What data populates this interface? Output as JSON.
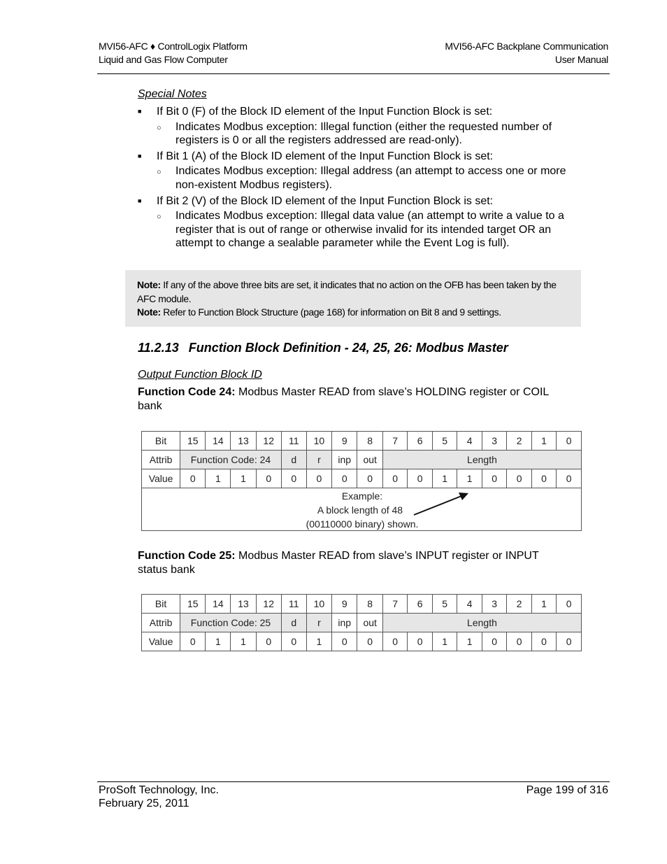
{
  "header": {
    "left_line1": "MVI56-AFC ♦ ControlLogix Platform",
    "left_line2": "Liquid and Gas Flow Computer",
    "right_line1": "MVI56-AFC Backplane Communication",
    "right_line2": "User Manual"
  },
  "special_notes": {
    "title": "Special Notes",
    "items": [
      {
        "text": "If Bit 0 (F) of the Block ID element of the Input Function Block is set:",
        "sub": "Indicates Modbus exception: Illegal function (either the requested number of registers is 0 or all the registers addressed are read-only)."
      },
      {
        "text": "If Bit 1 (A) of the Block ID element of the Input Function Block is set:",
        "sub": "Indicates Modbus exception: Illegal address (an attempt to access one or more non-existent Modbus registers)."
      },
      {
        "text": "If Bit 2 (V) of the Block ID element of the Input Function Block is set:",
        "sub": "Indicates Modbus exception: Illegal data value (an attempt to write a value to a register that is out of range or otherwise invalid for its intended target OR an attempt to change a sealable parameter while the Event Log is full)."
      }
    ]
  },
  "note_box": {
    "note1_label": "Note:",
    "note1_text": " If any of the above three bits are set, it indicates that no action on the OFB has been taken by the AFC module.",
    "note2_label": "Note:",
    "note2_text": " Refer to Function Block Structure (page 168) for information on Bit 8 and 9 settings."
  },
  "section": {
    "number": "11.2.13",
    "title": "Function Block Definition - 24, 25, 26: Modbus Master"
  },
  "ofb_title": "Output Function Block ID",
  "fc24": {
    "label": "Function Code 24:",
    "text": " Modbus Master READ from slave’s HOLDING register or COIL bank",
    "table": {
      "row_labels": [
        "Bit",
        "Attrib",
        "Value"
      ],
      "bits": [
        "15",
        "14",
        "13",
        "12",
        "11",
        "10",
        "9",
        "8",
        "7",
        "6",
        "5",
        "4",
        "3",
        "2",
        "1",
        "0"
      ],
      "attribs": {
        "function_code": "Function Code: 24",
        "d": "d",
        "r": "r",
        "inp": "inp",
        "out": "out",
        "length": "Length"
      },
      "values": [
        "0",
        "1",
        "1",
        "0",
        "0",
        "0",
        "0",
        "0",
        "0",
        "0",
        "1",
        "1",
        "0",
        "0",
        "0",
        "0"
      ],
      "example": {
        "line1": "Example:",
        "line2": "A block length of 48",
        "line3": "(00110000 binary) shown."
      }
    }
  },
  "fc25": {
    "label": "Function Code 25:",
    "text": " Modbus Master READ from slave’s INPUT register or INPUT status bank",
    "table": {
      "row_labels": [
        "Bit",
        "Attrib",
        "Value"
      ],
      "bits": [
        "15",
        "14",
        "13",
        "12",
        "11",
        "10",
        "9",
        "8",
        "7",
        "6",
        "5",
        "4",
        "3",
        "2",
        "1",
        "0"
      ],
      "attribs": {
        "function_code": "Function Code: 25",
        "d": "d",
        "r": "r",
        "inp": "inp",
        "out": "out",
        "length": "Length"
      },
      "values": [
        "0",
        "1",
        "1",
        "0",
        "0",
        "1",
        "0",
        "0",
        "0",
        "0",
        "1",
        "1",
        "0",
        "0",
        "0",
        "0"
      ]
    }
  },
  "footer": {
    "company": "ProSoft Technology, Inc.",
    "date": "February 25, 2011",
    "page": "Page 199 of 316"
  }
}
